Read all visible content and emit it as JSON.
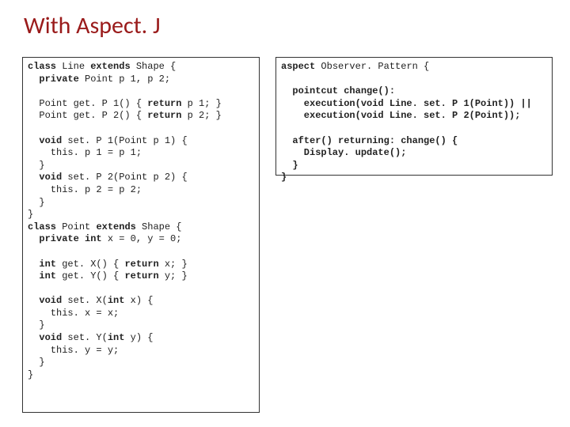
{
  "title": "With Aspect. J",
  "left_code": {
    "tokens": [
      {
        "t": "class ",
        "b": true
      },
      {
        "t": "Line ",
        "b": false
      },
      {
        "t": "extends ",
        "b": true
      },
      {
        "t": "Shape { ",
        "b": false
      },
      {
        "t": "\n",
        "b": false
      },
      {
        "t": "  private ",
        "b": true
      },
      {
        "t": "Point p 1, p 2;",
        "b": false
      },
      {
        "t": "\n",
        "b": false
      },
      {
        "t": "\n",
        "b": false
      },
      {
        "t": "  Point get. P 1() { ",
        "b": false
      },
      {
        "t": "return",
        "b": true
      },
      {
        "t": " p 1; }",
        "b": false
      },
      {
        "t": "\n",
        "b": false
      },
      {
        "t": "  Point get. P 2() { ",
        "b": false
      },
      {
        "t": "return",
        "b": true
      },
      {
        "t": " p 2; }",
        "b": false
      },
      {
        "t": "\n",
        "b": false
      },
      {
        "t": "\n",
        "b": false
      },
      {
        "t": "  void ",
        "b": true
      },
      {
        "t": "set. P 1(Point p 1) {",
        "b": false
      },
      {
        "t": "\n",
        "b": false
      },
      {
        "t": "    this. p 1 = p 1;",
        "b": false
      },
      {
        "t": "\n",
        "b": false
      },
      {
        "t": "  }",
        "b": false
      },
      {
        "t": "\n",
        "b": false
      },
      {
        "t": "  void ",
        "b": true
      },
      {
        "t": "set. P 2(Point p 2) {",
        "b": false
      },
      {
        "t": "\n",
        "b": false
      },
      {
        "t": "    this. p 2 = p 2;",
        "b": false
      },
      {
        "t": "\n",
        "b": false
      },
      {
        "t": "  }",
        "b": false
      },
      {
        "t": "\n",
        "b": false
      },
      {
        "t": "}",
        "b": false
      },
      {
        "t": "\n",
        "b": false
      },
      {
        "t": "class ",
        "b": true
      },
      {
        "t": "Point ",
        "b": false
      },
      {
        "t": "extends ",
        "b": true
      },
      {
        "t": "Shape {",
        "b": false
      },
      {
        "t": "\n",
        "b": false
      },
      {
        "t": "  private int ",
        "b": true
      },
      {
        "t": "x = 0, y = 0;",
        "b": false
      },
      {
        "t": "\n",
        "b": false
      },
      {
        "t": "\n",
        "b": false
      },
      {
        "t": "  int ",
        "b": true
      },
      {
        "t": "get. X() { ",
        "b": false
      },
      {
        "t": "return",
        "b": true
      },
      {
        "t": " x; }",
        "b": false
      },
      {
        "t": "\n",
        "b": false
      },
      {
        "t": "  int ",
        "b": true
      },
      {
        "t": "get. Y() { ",
        "b": false
      },
      {
        "t": "return",
        "b": true
      },
      {
        "t": " y; }",
        "b": false
      },
      {
        "t": "\n",
        "b": false
      },
      {
        "t": "\n",
        "b": false
      },
      {
        "t": "  void ",
        "b": true
      },
      {
        "t": "set. X(",
        "b": false
      },
      {
        "t": "int",
        "b": true
      },
      {
        "t": " x) {",
        "b": false
      },
      {
        "t": "\n",
        "b": false
      },
      {
        "t": "    this. x = x;",
        "b": false
      },
      {
        "t": "\n",
        "b": false
      },
      {
        "t": "  }",
        "b": false
      },
      {
        "t": "\n",
        "b": false
      },
      {
        "t": "  void ",
        "b": true
      },
      {
        "t": "set. Y(",
        "b": false
      },
      {
        "t": "int",
        "b": true
      },
      {
        "t": " y) {",
        "b": false
      },
      {
        "t": "\n",
        "b": false
      },
      {
        "t": "    this. y = y;",
        "b": false
      },
      {
        "t": "\n",
        "b": false
      },
      {
        "t": "  }",
        "b": false
      },
      {
        "t": "\n",
        "b": false
      },
      {
        "t": "}",
        "b": false
      }
    ]
  },
  "right_code": {
    "tokens": [
      {
        "t": "aspect",
        "b": true
      },
      {
        "t": " Observer. Pattern {",
        "b": false
      },
      {
        "t": "\n",
        "b": false
      },
      {
        "t": "\n",
        "b": false
      },
      {
        "t": "  pointcut change():",
        "b": true
      },
      {
        "t": "\n",
        "b": false
      },
      {
        "t": "    execution(void Line. set. P 1(Point)) ||",
        "b": true
      },
      {
        "t": "\n",
        "b": false
      },
      {
        "t": "    execution(void Line. set. P 2(Point));",
        "b": true
      },
      {
        "t": "\n",
        "b": false
      },
      {
        "t": "\n",
        "b": false
      },
      {
        "t": "  after() returning: change() {",
        "b": true
      },
      {
        "t": "\n",
        "b": false
      },
      {
        "t": "    Display. update();",
        "b": true
      },
      {
        "t": "\n",
        "b": false
      },
      {
        "t": "  }",
        "b": true
      },
      {
        "t": "\n",
        "b": false
      },
      {
        "t": "}",
        "b": true
      }
    ]
  }
}
